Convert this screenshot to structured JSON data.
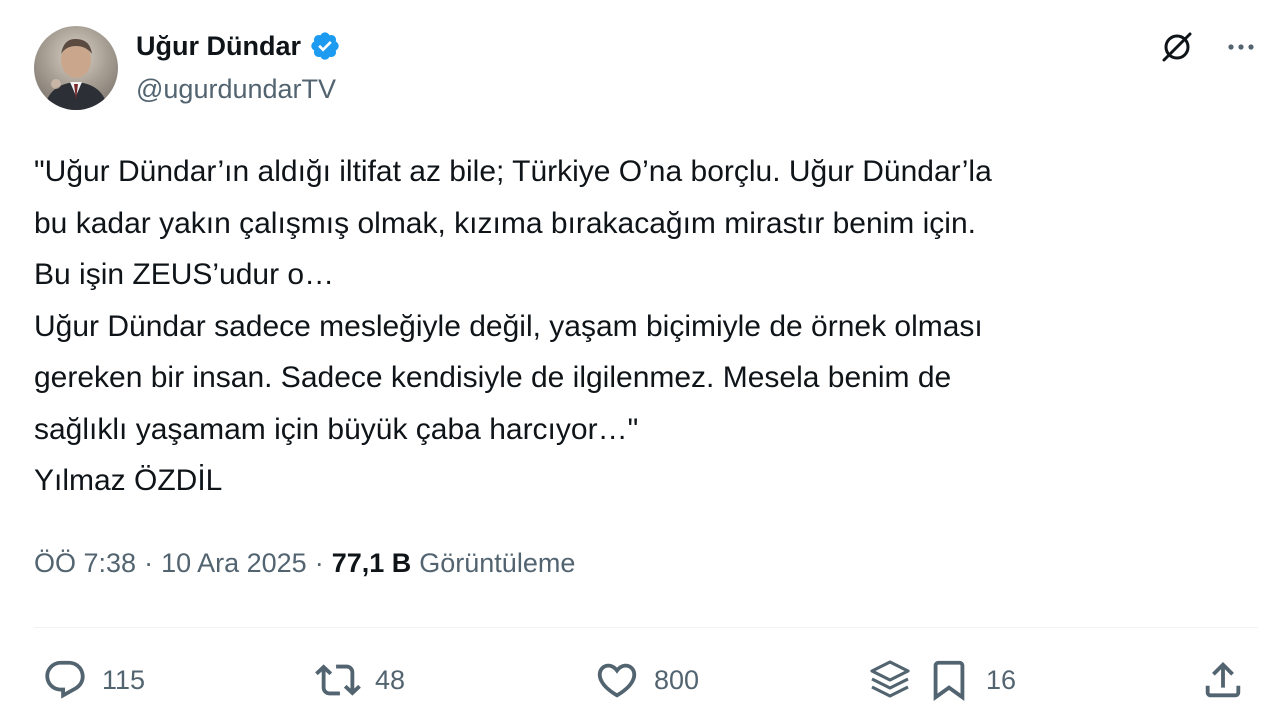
{
  "author": {
    "display_name": "Uğur Dündar",
    "handle": "@ugurdundarTV",
    "verified": true
  },
  "tweet": {
    "lines": [
      "\"Uğur Dündar’ın aldığı iltifat az bile; Türkiye O’na borçlu. Uğur Dündar’la",
      "bu kadar yakın çalışmış olmak, kızıma bırakacağım mirastır benim için.",
      "Bu işin ZEUS’udur o…",
      "Uğur Dündar sadece mesleğiyle değil, yaşam biçimiyle de örnek olması",
      "gereken bir insan. Sadece kendisiyle de ilgilenmez. Mesela benim de",
      "sağlıklı yaşamam için büyük çaba harcıyor…\"",
      "Yılmaz ÖZDİL"
    ]
  },
  "meta": {
    "time": "ÖÖ 7:38",
    "date": "10 Ara 2025",
    "separator": "·",
    "views_count": "77,1 B",
    "views_label": "Görüntüleme"
  },
  "actions": {
    "replies": "115",
    "reposts": "48",
    "likes": "800",
    "bookmarks": "16"
  },
  "colors": {
    "text": "#0f1419",
    "secondary": "#536471",
    "verified": "#1d9bf0"
  },
  "icons": [
    "grok-icon",
    "more-icon",
    "reply-icon",
    "repost-icon",
    "like-icon",
    "analytics-icon",
    "bookmark-icon",
    "share-icon",
    "verified-badge-icon"
  ]
}
